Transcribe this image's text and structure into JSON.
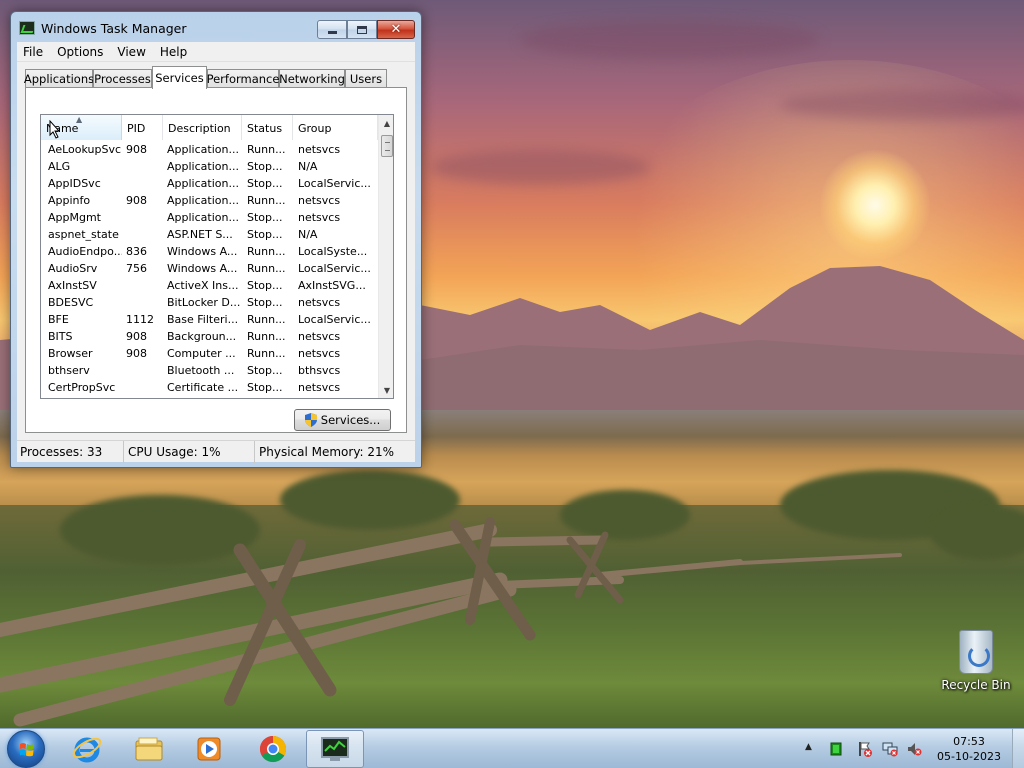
{
  "window": {
    "title": "Windows Task Manager",
    "menu": [
      "File",
      "Options",
      "View",
      "Help"
    ],
    "tabs": [
      "Applications",
      "Processes",
      "Services",
      "Performance",
      "Networking",
      "Users"
    ],
    "active_tab": "Services"
  },
  "services": {
    "columns": [
      "Name",
      "PID",
      "Description",
      "Status",
      "Group"
    ],
    "sorted_column": "Name",
    "rows": [
      {
        "name": "AeLookupSvc",
        "pid": "908",
        "description": "Application...",
        "status": "Runn...",
        "group": "netsvcs"
      },
      {
        "name": "ALG",
        "pid": "",
        "description": "Application...",
        "status": "Stop...",
        "group": "N/A"
      },
      {
        "name": "AppIDSvc",
        "pid": "",
        "description": "Application...",
        "status": "Stop...",
        "group": "LocalServic..."
      },
      {
        "name": "Appinfo",
        "pid": "908",
        "description": "Application...",
        "status": "Runn...",
        "group": "netsvcs"
      },
      {
        "name": "AppMgmt",
        "pid": "",
        "description": "Application...",
        "status": "Stop...",
        "group": "netsvcs"
      },
      {
        "name": "aspnet_state",
        "pid": "",
        "description": "ASP.NET S...",
        "status": "Stop...",
        "group": "N/A"
      },
      {
        "name": "AudioEndpo...",
        "pid": "836",
        "description": "Windows A...",
        "status": "Runn...",
        "group": "LocalSyste..."
      },
      {
        "name": "AudioSrv",
        "pid": "756",
        "description": "Windows A...",
        "status": "Runn...",
        "group": "LocalServic..."
      },
      {
        "name": "AxInstSV",
        "pid": "",
        "description": "ActiveX Ins...",
        "status": "Stop...",
        "group": "AxInstSVG..."
      },
      {
        "name": "BDESVC",
        "pid": "",
        "description": "BitLocker D...",
        "status": "Stop...",
        "group": "netsvcs"
      },
      {
        "name": "BFE",
        "pid": "1112",
        "description": "Base Filteri...",
        "status": "Runn...",
        "group": "LocalServic..."
      },
      {
        "name": "BITS",
        "pid": "908",
        "description": "Backgroun...",
        "status": "Runn...",
        "group": "netsvcs"
      },
      {
        "name": "Browser",
        "pid": "908",
        "description": "Computer ...",
        "status": "Runn...",
        "group": "netsvcs"
      },
      {
        "name": "bthserv",
        "pid": "",
        "description": "Bluetooth ...",
        "status": "Stop...",
        "group": "bthsvcs"
      },
      {
        "name": "CertPropSvc",
        "pid": "",
        "description": "Certificate ...",
        "status": "Stop...",
        "group": "netsvcs"
      }
    ],
    "button_label": "Services..."
  },
  "status_bar": {
    "processes": "Processes: 33",
    "cpu": "CPU Usage: 1%",
    "memory": "Physical Memory: 21%"
  },
  "desktop": {
    "icons": [
      {
        "label": "Recycle Bin",
        "icon": "recycle-bin-icon"
      }
    ]
  },
  "taskbar": {
    "pinned": [
      "internet-explorer-icon",
      "file-explorer-icon",
      "media-player-icon",
      "chrome-icon",
      "task-manager-icon"
    ],
    "active_app": "task-manager-icon",
    "clock_time": "07:53",
    "clock_date": "05-10-2023"
  },
  "colors": {
    "selection_header": "#dbeefa",
    "close_button": "#c0321b",
    "taskbar": "#afc8e1"
  }
}
